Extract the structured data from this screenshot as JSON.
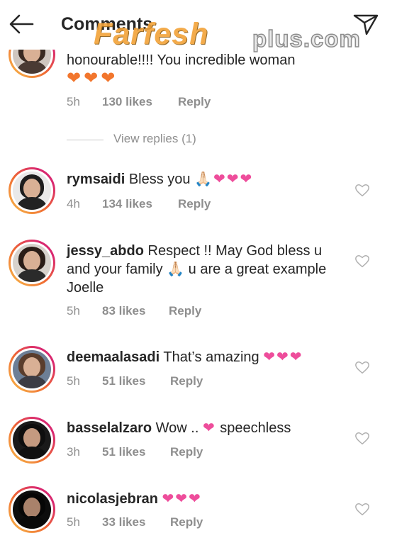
{
  "header": {
    "title": "Comments"
  },
  "watermark": {
    "brand": "Farfesh",
    "suffix": "plus.com"
  },
  "top_comment": {
    "text": "honourable!!!! You incredible woman",
    "emoji": "❤❤❤",
    "time": "5h",
    "likes": "130 likes",
    "reply": "Reply",
    "view_replies": "View replies (1)"
  },
  "comments": [
    {
      "username": "rymsaidi",
      "text": "Bless you",
      "emoji": "🙏🏻❤❤❤",
      "time": "4h",
      "likes": "134 likes",
      "reply": "Reply"
    },
    {
      "username": "jessy_abdo",
      "text": "Respect !! May God bless u and your family",
      "emoji": "🙏🏻",
      "text2": "u are a great example Joelle",
      "time": "5h",
      "likes": "83 likes",
      "reply": "Reply"
    },
    {
      "username": "deemaalasadi",
      "text": "That’s amazing",
      "emoji": "❤❤❤",
      "time": "5h",
      "likes": "51 likes",
      "reply": "Reply"
    },
    {
      "username": "basselalzaro",
      "text": "Wow ..",
      "emoji": "❤",
      "text2": "speechless",
      "time": "3h",
      "likes": "51 likes",
      "reply": "Reply"
    },
    {
      "username": "nicolasjebran",
      "text": "",
      "emoji": "❤❤❤",
      "time": "5h",
      "likes": "33 likes",
      "reply": "Reply"
    }
  ],
  "colors": {
    "heart_pink": "#ee4d9b",
    "heart_orange": "#f2762d",
    "muted": "#8e8e8e",
    "ring_start": "#f8c04a",
    "ring_end": "#d9286f"
  },
  "icons": {
    "back": "back-arrow-icon",
    "share": "direct-share-icon",
    "like": "heart-outline-icon"
  }
}
